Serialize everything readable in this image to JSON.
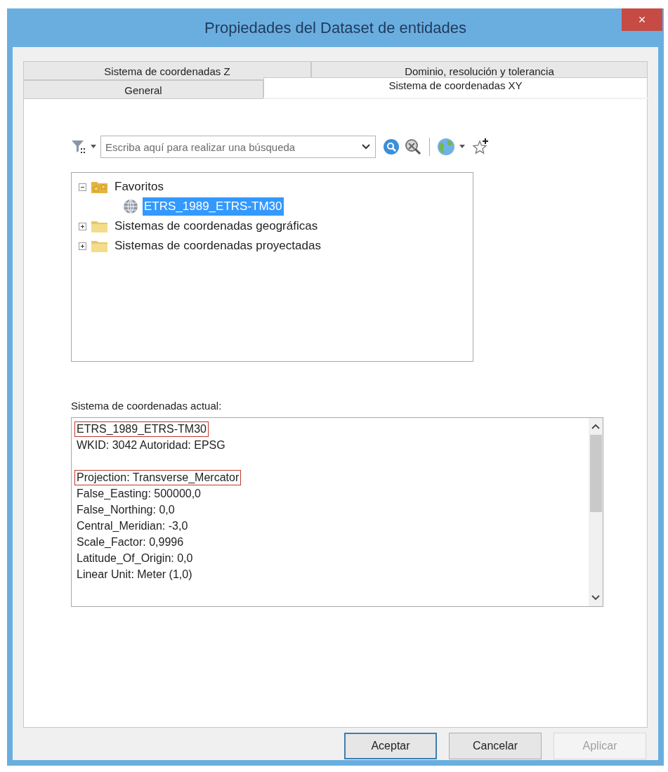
{
  "window": {
    "title": "Propiedades del Dataset de entidades",
    "close": "×"
  },
  "tab_rows": [
    [
      {
        "label": "Sistema de coordenadas Z",
        "selected": false
      },
      {
        "label": "Dominio, resolución y tolerancia",
        "selected": false
      }
    ],
    [
      {
        "label": "General",
        "selected": false
      },
      {
        "label": "Sistema de coordenadas XY",
        "selected": true
      }
    ]
  ],
  "search": {
    "placeholder": "Escriba aquí para realizar una búsqueda"
  },
  "tree": [
    {
      "label": "Favoritos",
      "kind": "favorites",
      "expanded": true,
      "selected": false,
      "children": [
        {
          "label": "ETRS_1989_ETRS-TM30",
          "kind": "system",
          "selected": true
        }
      ]
    },
    {
      "label": "Sistemas de coordenadas geográficas",
      "kind": "folder",
      "expanded": false,
      "selected": false
    },
    {
      "label": "Sistemas de coordenadas proyectadas",
      "kind": "folder",
      "expanded": false,
      "selected": false
    }
  ],
  "current": {
    "label": "Sistema de coordenadas actual:",
    "lines": [
      {
        "kind": "text",
        "text": "ETRS_1989_ETRS-TM30",
        "outlined": true
      },
      {
        "kind": "text",
        "text": "WKID: 3042 Autoridad: EPSG",
        "outlined": false
      },
      {
        "kind": "gap"
      },
      {
        "kind": "text",
        "text": "Projection: Transverse_Mercator",
        "outlined": true
      },
      {
        "kind": "text",
        "text": "False_Easting: 500000,0",
        "outlined": false
      },
      {
        "kind": "text",
        "text": "False_Northing: 0,0",
        "outlined": false
      },
      {
        "kind": "text",
        "text": "Central_Meridian: -3,0",
        "outlined": false
      },
      {
        "kind": "text",
        "text": "Scale_Factor: 0,9996",
        "outlined": false
      },
      {
        "kind": "text",
        "text": "Latitude_Of_Origin: 0,0",
        "outlined": false
      },
      {
        "kind": "text",
        "text": "Linear Unit: Meter (1,0)",
        "outlined": false
      }
    ]
  },
  "buttons": [
    {
      "label": "Aceptar",
      "default": true,
      "disabled": false
    },
    {
      "label": "Cancelar",
      "default": false,
      "disabled": false
    },
    {
      "label": "Aplicar",
      "default": false,
      "disabled": true
    }
  ]
}
